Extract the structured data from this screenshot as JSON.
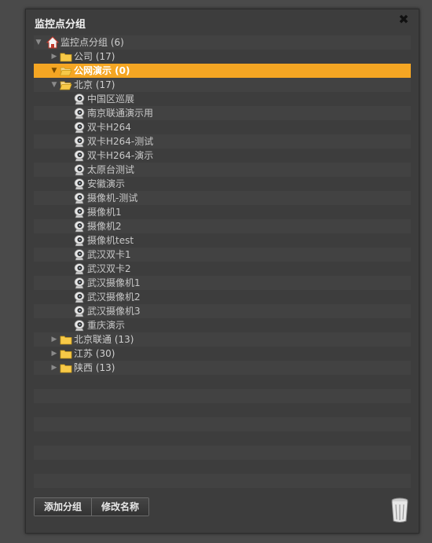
{
  "dialog": {
    "title": "监控点分组",
    "close_glyph": "✖"
  },
  "tree": {
    "root": {
      "label": "监控点分组 (6)",
      "icon": "home-icon",
      "expanded": true
    },
    "nodes": [
      {
        "id": "gongsi",
        "label": "公司 (17)",
        "icon": "folder-icon",
        "expanded": false,
        "selected": false
      },
      {
        "id": "gongwang",
        "label": "公网演示 (0)",
        "icon": "folder-open-icon",
        "expanded": true,
        "selected": true
      },
      {
        "id": "beijing",
        "label": "北京 (17)",
        "icon": "folder-open-icon",
        "expanded": true,
        "selected": false,
        "children": [
          "中国区巡展",
          "南京联通演示用",
          "双卡H264",
          "双卡H264-测试",
          "双卡H264-演示",
          "太原台测试",
          "安徽演示",
          "摄像机-测试",
          "摄像机1",
          "摄像机2",
          "摄像机test",
          "武汉双卡1",
          "武汉双卡2",
          "武汉摄像机1",
          "武汉摄像机2",
          "武汉摄像机3",
          "重庆演示"
        ]
      },
      {
        "id": "beijing-liantong",
        "label": "北京联通 (13)",
        "icon": "folder-icon",
        "expanded": false,
        "selected": false
      },
      {
        "id": "jiangsu",
        "label": "江苏 (30)",
        "icon": "folder-icon",
        "expanded": false,
        "selected": false
      },
      {
        "id": "shaanxi",
        "label": "陕西 (13)",
        "icon": "folder-icon",
        "expanded": false,
        "selected": false
      }
    ]
  },
  "footer": {
    "add_group_label": "添加分组",
    "rename_label": "修改名称",
    "trash_icon": "trash-icon"
  },
  "colors": {
    "selected_bg": "#f5a623",
    "folder": "#f7c948"
  }
}
